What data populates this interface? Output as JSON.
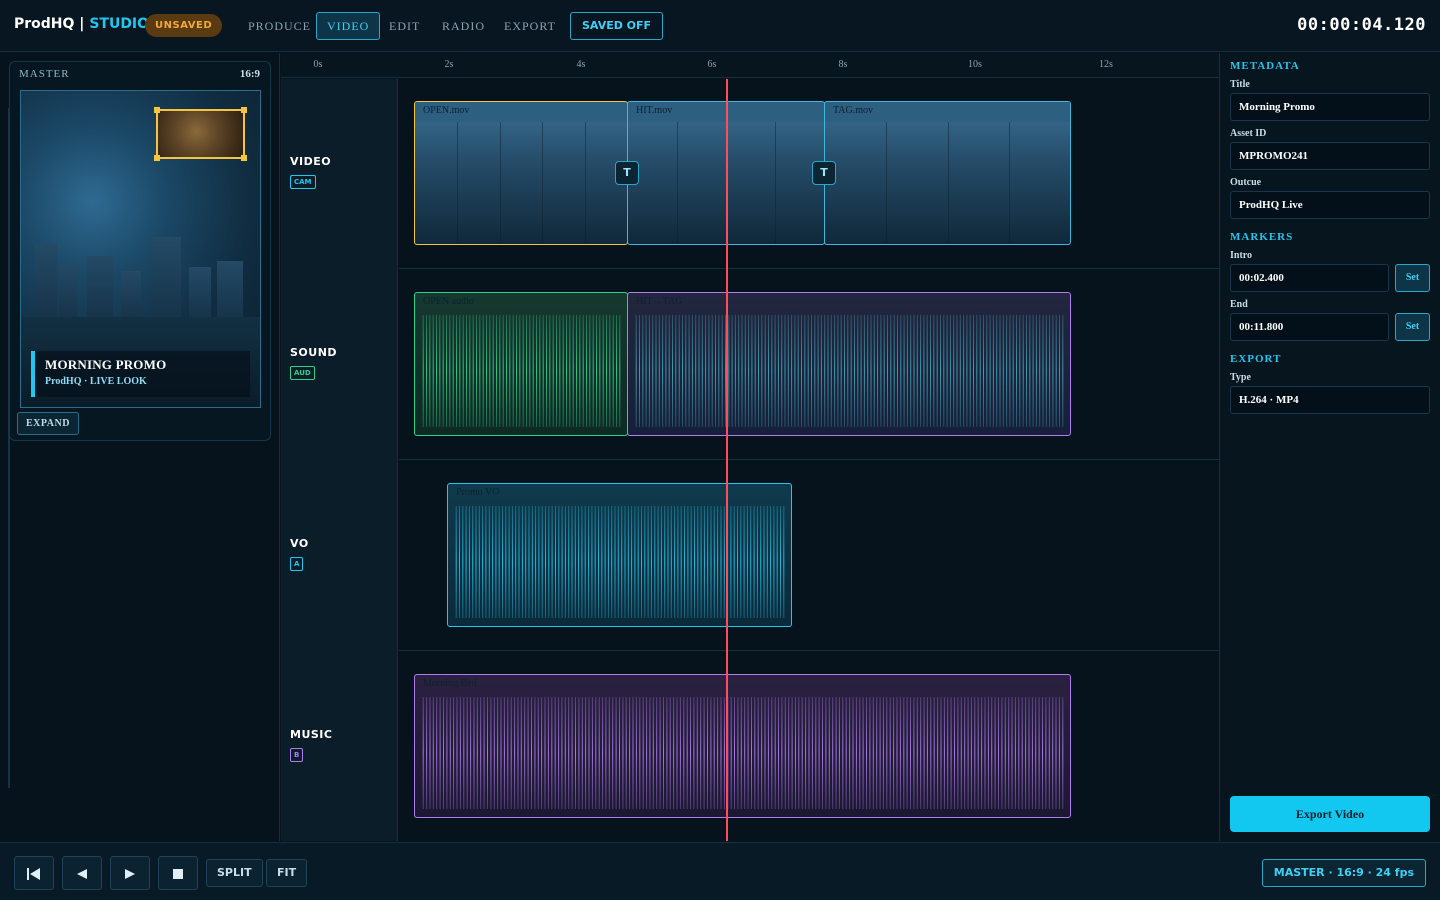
{
  "header": {
    "brand": "ProdHQ",
    "brand_separator": " | ",
    "brand_accent": "STUDIO",
    "unsaved_badge": "UNSAVED",
    "nav": [
      {
        "label": "PRODUCE",
        "active": false
      },
      {
        "label": "VIDEO",
        "active": true
      },
      {
        "label": "EDIT",
        "active": false
      },
      {
        "label": "RADIO",
        "active": false
      },
      {
        "label": "EXPORT",
        "active": false
      }
    ],
    "saved_toggle": "SAVED OFF",
    "timecode": "00:00:04.120"
  },
  "preview": {
    "label": "MASTER",
    "ratio": "16:9",
    "lower_third_title": "MORNING PROMO",
    "lower_third_sub": "ProdHQ · LIVE LOOK",
    "expand_label": "EXPAND"
  },
  "ruler": {
    "ticks": [
      "0s",
      "2s",
      "4s",
      "6s",
      "8s",
      "10s",
      "12s"
    ]
  },
  "tracks": [
    {
      "name": "VIDEO",
      "tag": "CAM",
      "color": "#23c6ee"
    },
    {
      "name": "SOUND",
      "tag": "AUD",
      "color": "#2fd08a"
    },
    {
      "name": "VO",
      "tag": "A",
      "color": "#23c6ee"
    },
    {
      "name": "MUSIC",
      "tag": "B",
      "color": "#b07cf0"
    }
  ],
  "clips": {
    "video": [
      {
        "label": "OPEN.mov",
        "border": "#f5c542"
      },
      {
        "label": "HIT.mov",
        "border": "#3fb8dd"
      },
      {
        "label": "TAG.mov",
        "border": "#3fb8dd"
      }
    ],
    "transition_icon": "T",
    "sound": [
      {
        "label": "OPEN audio",
        "color": "#2fd08a"
      },
      {
        "label": "HIT→TAG",
        "color": "#b07cf0"
      }
    ],
    "vo": [
      {
        "label": "Promo VO",
        "color": "#23c6ee"
      }
    ],
    "music": [
      {
        "label": "Morning Bed",
        "color": "#b07cf0"
      }
    ]
  },
  "inspector": {
    "metadata_title": "METADATA",
    "fields": [
      {
        "label": "Title",
        "value": "Morning Promo"
      },
      {
        "label": "Asset ID",
        "value": "MPROMO241"
      },
      {
        "label": "Outcue",
        "value": "ProdHQ Live"
      }
    ],
    "markers_title": "MARKERS",
    "markers": [
      {
        "label": "Intro",
        "value": "00:02.400",
        "button": "Set"
      },
      {
        "label": "End",
        "value": "00:11.800",
        "button": "Set"
      }
    ],
    "export_title": "EXPORT",
    "export_type_label": "Type",
    "export_type_value": "H.264 · MP4",
    "export_button": "Export Video"
  },
  "transport": {
    "icons": [
      "skip-to-start-icon",
      "step-back-icon",
      "play-icon",
      "stop-icon"
    ],
    "split_label": "SPLIT",
    "fit_label": "FIT",
    "status": "MASTER · 16:9 · 24 fps"
  },
  "colors": {
    "accent": "#23c6ee",
    "warning": "#f1a93a",
    "playhead": "#ff4d5e",
    "audio_green": "#2fd08a",
    "music_purple": "#b07cf0"
  }
}
